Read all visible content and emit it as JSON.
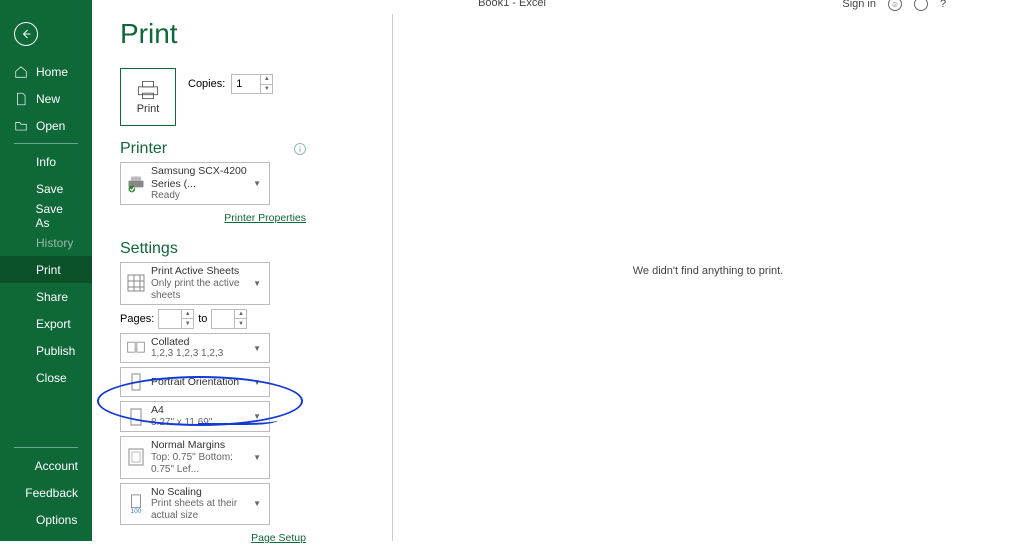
{
  "titlebar": {
    "doc": "Book1 - Excel",
    "signin": "Sign in"
  },
  "sidebar": {
    "home": "Home",
    "new": "New",
    "open": "Open",
    "info": "Info",
    "save": "Save",
    "saveas": "Save As",
    "history": "History",
    "print": "Print",
    "share": "Share",
    "export": "Export",
    "publish": "Publish",
    "close": "Close",
    "account": "Account",
    "feedback": "Feedback",
    "options": "Options"
  },
  "page": {
    "title": "Print",
    "print_button": "Print",
    "copies_label": "Copies:",
    "copies_value": "1"
  },
  "printer": {
    "heading": "Printer",
    "name": "Samsung SCX-4200 Series (...",
    "status": "Ready",
    "properties_link": "Printer Properties"
  },
  "settings": {
    "heading": "Settings",
    "active_sheets_t": "Print Active Sheets",
    "active_sheets_s": "Only print the active sheets",
    "pages_label": "Pages:",
    "pages_to": "to",
    "collated_t": "Collated",
    "collated_s": "1,2,3    1,2,3    1,2,3",
    "orient_t": "Portrait Orientation",
    "paper_t": "A4",
    "paper_s": "8.27\" x 11.69\"",
    "margins_t": "Normal Margins",
    "margins_s": "Top: 0.75\" Bottom: 0.75\" Lef...",
    "scaling_t": "No Scaling",
    "scaling_s": "Print sheets at their actual size",
    "page_setup_link": "Page Setup"
  },
  "preview": {
    "empty_msg": "We didn't find anything to print."
  }
}
